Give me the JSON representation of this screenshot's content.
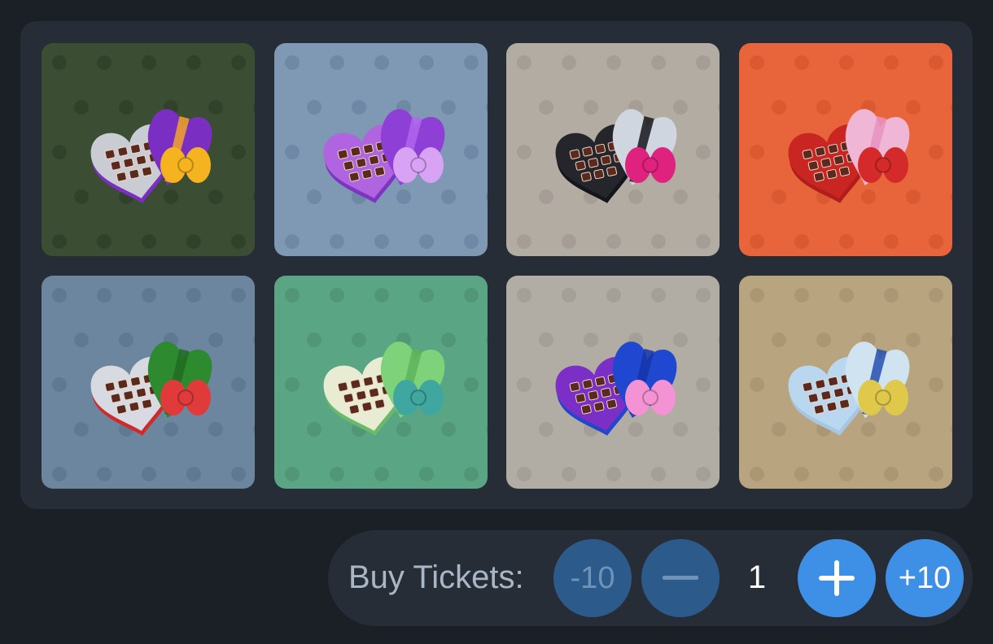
{
  "items": [
    {
      "name": "purple-gold-heart-box",
      "background": "#3b4d33",
      "pattern": "#2f4029",
      "lid": "#7a2fc2",
      "lid_stripe": "#f2a32b",
      "box": "#c9ccd3",
      "bow": "#f5b41f",
      "rim": "#7a2fc2"
    },
    {
      "name": "violet-heart-box",
      "background": "#7f98b4",
      "pattern": "#6c85a1",
      "lid": "#8e3fd6",
      "lid_stripe": "#b066ee",
      "box": "#b064e0",
      "bow": "#d9a3f5",
      "rim": "#7b35c0"
    },
    {
      "name": "black-white-heart-box",
      "background": "#b3aca3",
      "pattern": "#a29b92",
      "lid": "#cfd6e0",
      "lid_stripe": "#15161a",
      "box": "#25262b",
      "bow": "#e0227f",
      "rim": "#15161a"
    },
    {
      "name": "red-pink-heart-box",
      "background": "#e8643a",
      "pattern": "#d6562f",
      "lid": "#f0b6d6",
      "lid_stripe": "#e892c2",
      "box": "#c92623",
      "bow": "#d42a2a",
      "rim": "#b01e1c"
    },
    {
      "name": "green-red-heart-box",
      "background": "#6d86a0",
      "pattern": "#5d7690",
      "lid": "#2e8a2e",
      "lid_stripe": "#1f6b22",
      "box": "#d7dbe1",
      "bow": "#e03a3a",
      "rim": "#d02a2a"
    },
    {
      "name": "mint-heart-box",
      "background": "#5aa583",
      "pattern": "#4f9474",
      "lid": "#7ed37a",
      "lid_stripe": "#5eb45c",
      "box": "#e7ecd3",
      "bow": "#3fa6a0",
      "rim": "#6aba6b"
    },
    {
      "name": "blue-purple-heart-box",
      "background": "#b1aca4",
      "pattern": "#a19c94",
      "lid": "#1f47d0",
      "lid_stripe": "#1535a8",
      "box": "#7b2fc6",
      "bow": "#f393d4",
      "rim": "#2446c8"
    },
    {
      "name": "stained-glass-heart-box",
      "background": "#b8a580",
      "pattern": "#a79470",
      "lid": "#cfe3f0",
      "lid_stripe": "#244fb0",
      "box": "#b9d8f0",
      "bow": "#e0c84a",
      "rim": "#a6c6e2"
    }
  ],
  "buy": {
    "label": "Buy Tickets:",
    "minus10": "-10",
    "minus": "—",
    "quantity": "1",
    "plus": "+",
    "plus10": "+10"
  },
  "colors": {
    "page_bg": "#1b2026",
    "panel_bg": "#262d36",
    "button_dim": "#2c5a8a",
    "button_active": "#3e8fe6",
    "label_text": "#a8b6c6"
  }
}
